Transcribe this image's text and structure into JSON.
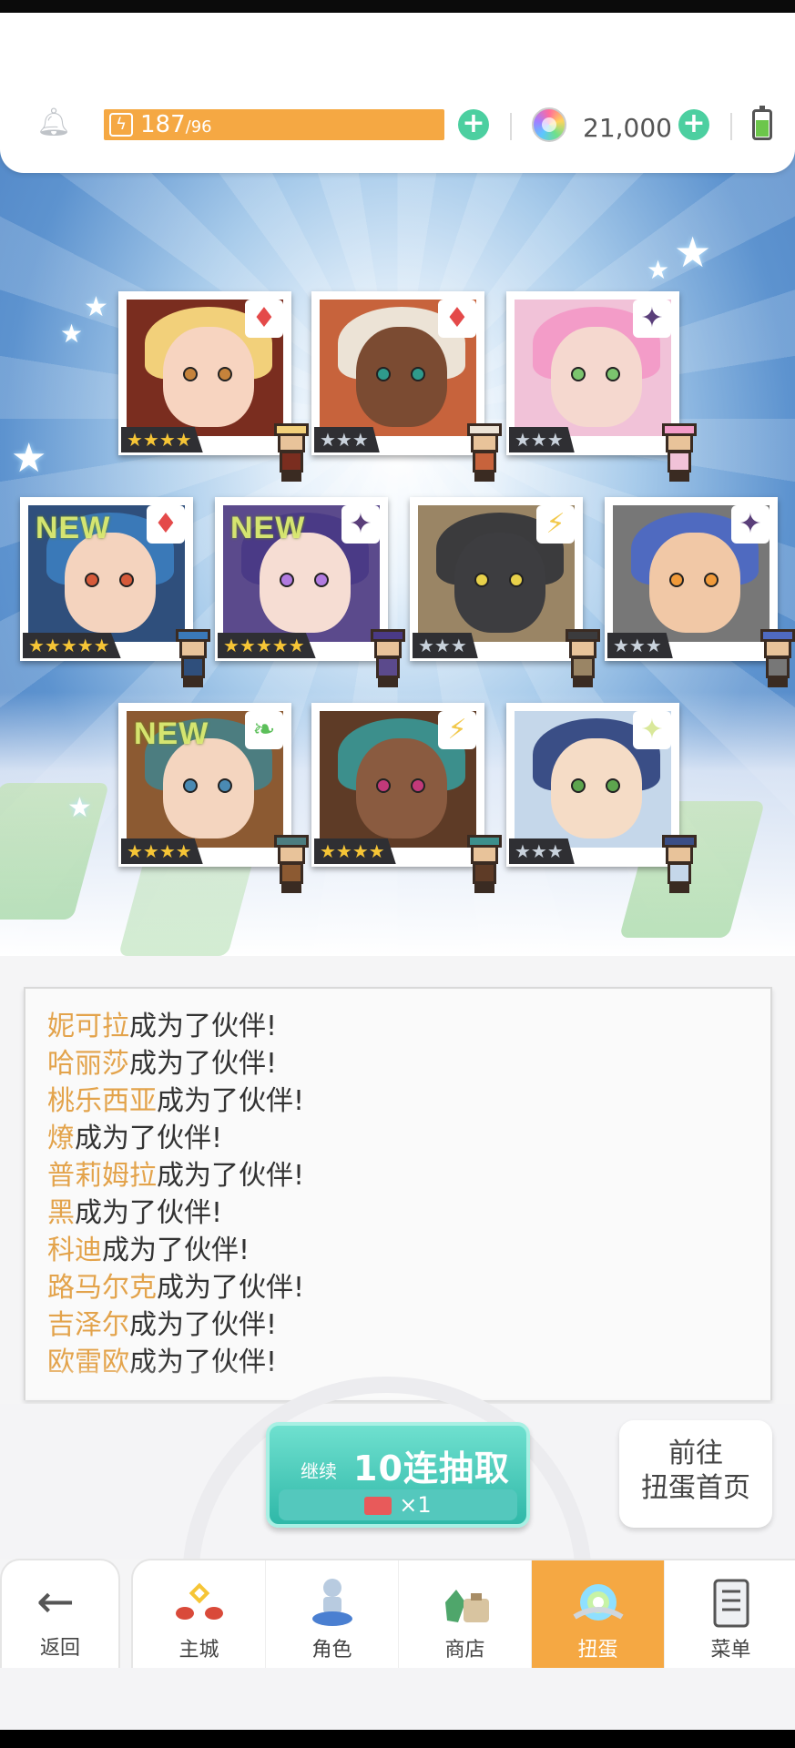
{
  "status": {
    "stamina_current": "187",
    "stamina_max": "/96",
    "gem_count": "21,000"
  },
  "colors": {
    "stamina": "#f5a843",
    "plus": "#4ccfa0",
    "name_highlight": "#e3a34b",
    "pull_button": "#2fb8a8",
    "nav_active": "#f5a843"
  },
  "cards": [
    {
      "rarity": 4,
      "stars": "★★★★",
      "attr_icon": "red-diamond-icon",
      "attr_glyph": "♦",
      "attr_color": "#e44a4a",
      "new": false,
      "new_label": ""
    },
    {
      "rarity": 3,
      "stars": "★★★",
      "attr_icon": "red-diamond-icon",
      "attr_glyph": "♦",
      "attr_color": "#e44a4a",
      "new": false,
      "new_label": ""
    },
    {
      "rarity": 3,
      "stars": "★★★",
      "attr_icon": "purple-star-icon",
      "attr_glyph": "✦",
      "attr_color": "#5a3f7a",
      "new": false,
      "new_label": ""
    },
    {
      "rarity": 5,
      "stars": "★★★★★",
      "attr_icon": "red-diamond-icon",
      "attr_glyph": "♦",
      "attr_color": "#e44a4a",
      "new": true,
      "new_label": "NEW"
    },
    {
      "rarity": 5,
      "stars": "★★★★★",
      "attr_icon": "purple-star-icon",
      "attr_glyph": "✦",
      "attr_color": "#5a3f7a",
      "new": true,
      "new_label": "NEW"
    },
    {
      "rarity": 3,
      "stars": "★★★",
      "attr_icon": "lightning-icon",
      "attr_glyph": "⚡",
      "attr_color": "#f2c94c",
      "new": false,
      "new_label": ""
    },
    {
      "rarity": 3,
      "stars": "★★★",
      "attr_icon": "purple-star-icon",
      "attr_glyph": "✦",
      "attr_color": "#5a3f7a",
      "new": false,
      "new_label": ""
    },
    {
      "rarity": 4,
      "stars": "★★★★",
      "attr_icon": "green-leaf-icon",
      "attr_glyph": "❧",
      "attr_color": "#5cbf5a",
      "new": true,
      "new_label": "NEW"
    },
    {
      "rarity": 4,
      "stars": "★★★★",
      "attr_icon": "lightning-icon",
      "attr_glyph": "⚡",
      "attr_color": "#f2c94c",
      "new": false,
      "new_label": ""
    },
    {
      "rarity": 3,
      "stars": "★★★",
      "attr_icon": "light-star-icon",
      "attr_glyph": "✦",
      "attr_color": "#d9e89a",
      "new": false,
      "new_label": ""
    }
  ],
  "log": {
    "suffix": "成为了伙伴!",
    "names": [
      "妮可拉",
      "哈丽莎",
      "桃乐西亚",
      "燎",
      "普莉姆拉",
      "黑",
      "科迪",
      "路马尔克",
      "吉泽尔",
      "欧雷欧"
    ]
  },
  "pull_button": {
    "continue": "继续",
    "label": "10连抽取",
    "ticket_count": "×1"
  },
  "home_button": {
    "line1": "前往",
    "line2": "扭蛋首页"
  },
  "nav": {
    "back": "返回",
    "items": [
      {
        "label": "主城",
        "icon": "castle-icon"
      },
      {
        "label": "角色",
        "icon": "character-icon"
      },
      {
        "label": "商店",
        "icon": "shop-icon"
      },
      {
        "label": "扭蛋",
        "icon": "gacha-icon",
        "active": true
      },
      {
        "label": "菜单",
        "icon": "menu-icon"
      }
    ]
  }
}
